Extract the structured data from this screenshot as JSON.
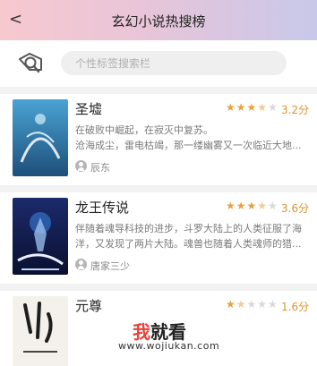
{
  "header": {
    "back_glyph": "<",
    "title": "玄幻小说热搜榜"
  },
  "search": {
    "icon": "tag-search-icon",
    "placeholder": "个性标签搜索栏"
  },
  "colors": {
    "accent": "#e8a03b",
    "rating": "#e0932f",
    "header_left": "#f7c9cf",
    "header_right": "#c8c8ea"
  },
  "books": [
    {
      "title": "圣墟",
      "rating": "3.2分",
      "stars": 3.5,
      "desc_line1": "在破败中崛起，在寂灭中复苏。",
      "desc_line2": "沧海成尘，雷电枯竭，那一缕幽雾又一次临近大地...",
      "author": "辰东"
    },
    {
      "title": "龙王传说",
      "rating": "3.6分",
      "stars": 3.5,
      "desc_line1": "伴随着魂导科技的进步，斗罗大陆上的人类征服了海",
      "desc_line2": "洋，又发现了两片大陆。魂兽也随着人类魂师的猎...",
      "author": "唐家三少"
    },
    {
      "title": "元尊",
      "rating": "1.6分",
      "stars": 1.5,
      "desc_line1": "",
      "desc_line2": "",
      "author": ""
    }
  ],
  "watermark": {
    "brand_red": "我",
    "brand_rest": "就看",
    "url": "www.wojiukan.com"
  }
}
